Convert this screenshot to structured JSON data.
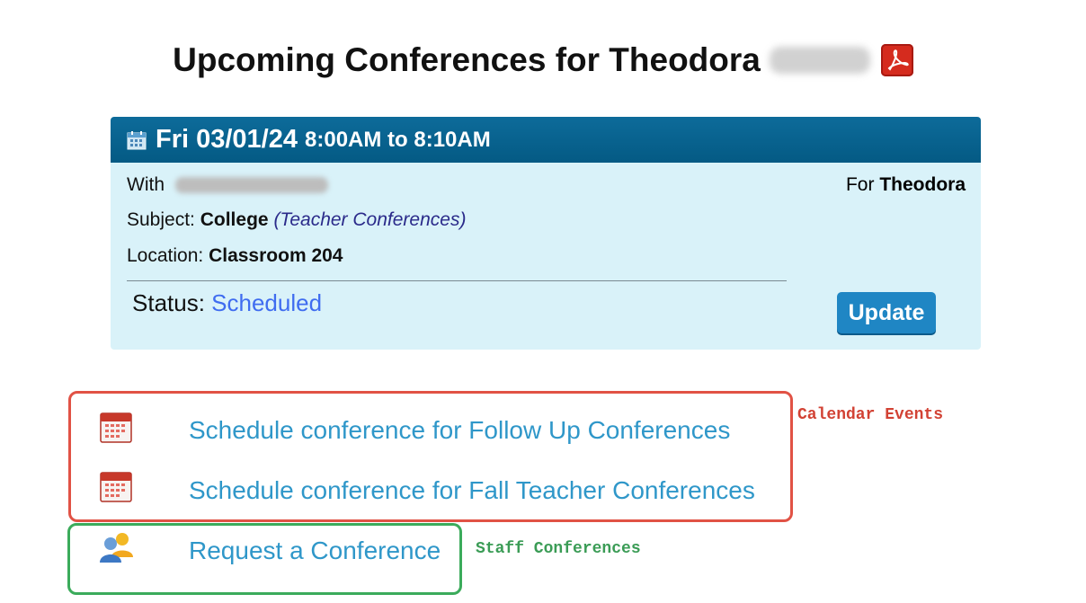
{
  "page": {
    "title_prefix": "Upcoming Conferences for Theodora",
    "pdf_icon": "pdf-icon"
  },
  "conference": {
    "day_date": "Fri 03/01/24",
    "time_range": "8:00AM to 8:10AM",
    "with_label": "With",
    "for_label": "For",
    "for_name": "Theodora",
    "subject_label": "Subject:",
    "subject_value": "College",
    "subject_category": "(Teacher Conferences)",
    "location_label": "Location:",
    "location_value": "Classroom 204",
    "status_label": "Status:",
    "status_value": "Scheduled",
    "update_label": "Update"
  },
  "actions": {
    "calendar_events": [
      {
        "label": "Schedule conference for Follow Up Conferences",
        "icon": "calendar-icon"
      },
      {
        "label": "Schedule conference for Fall Teacher Conferences",
        "icon": "calendar-icon"
      }
    ],
    "staff_conferences": [
      {
        "label": "Request a Conference",
        "icon": "users-icon"
      }
    ]
  },
  "annotations": {
    "calendar_events": "Calendar Events",
    "staff_conferences": "Staff Conferences"
  },
  "colors": {
    "header_bg": "#0d6b9a",
    "card_bg": "#d9f2f9",
    "link": "#2f97c9",
    "status": "#3f6cf0",
    "button": "#1f86c4",
    "annotation_red": "#e15245",
    "annotation_green": "#3bab5b"
  }
}
